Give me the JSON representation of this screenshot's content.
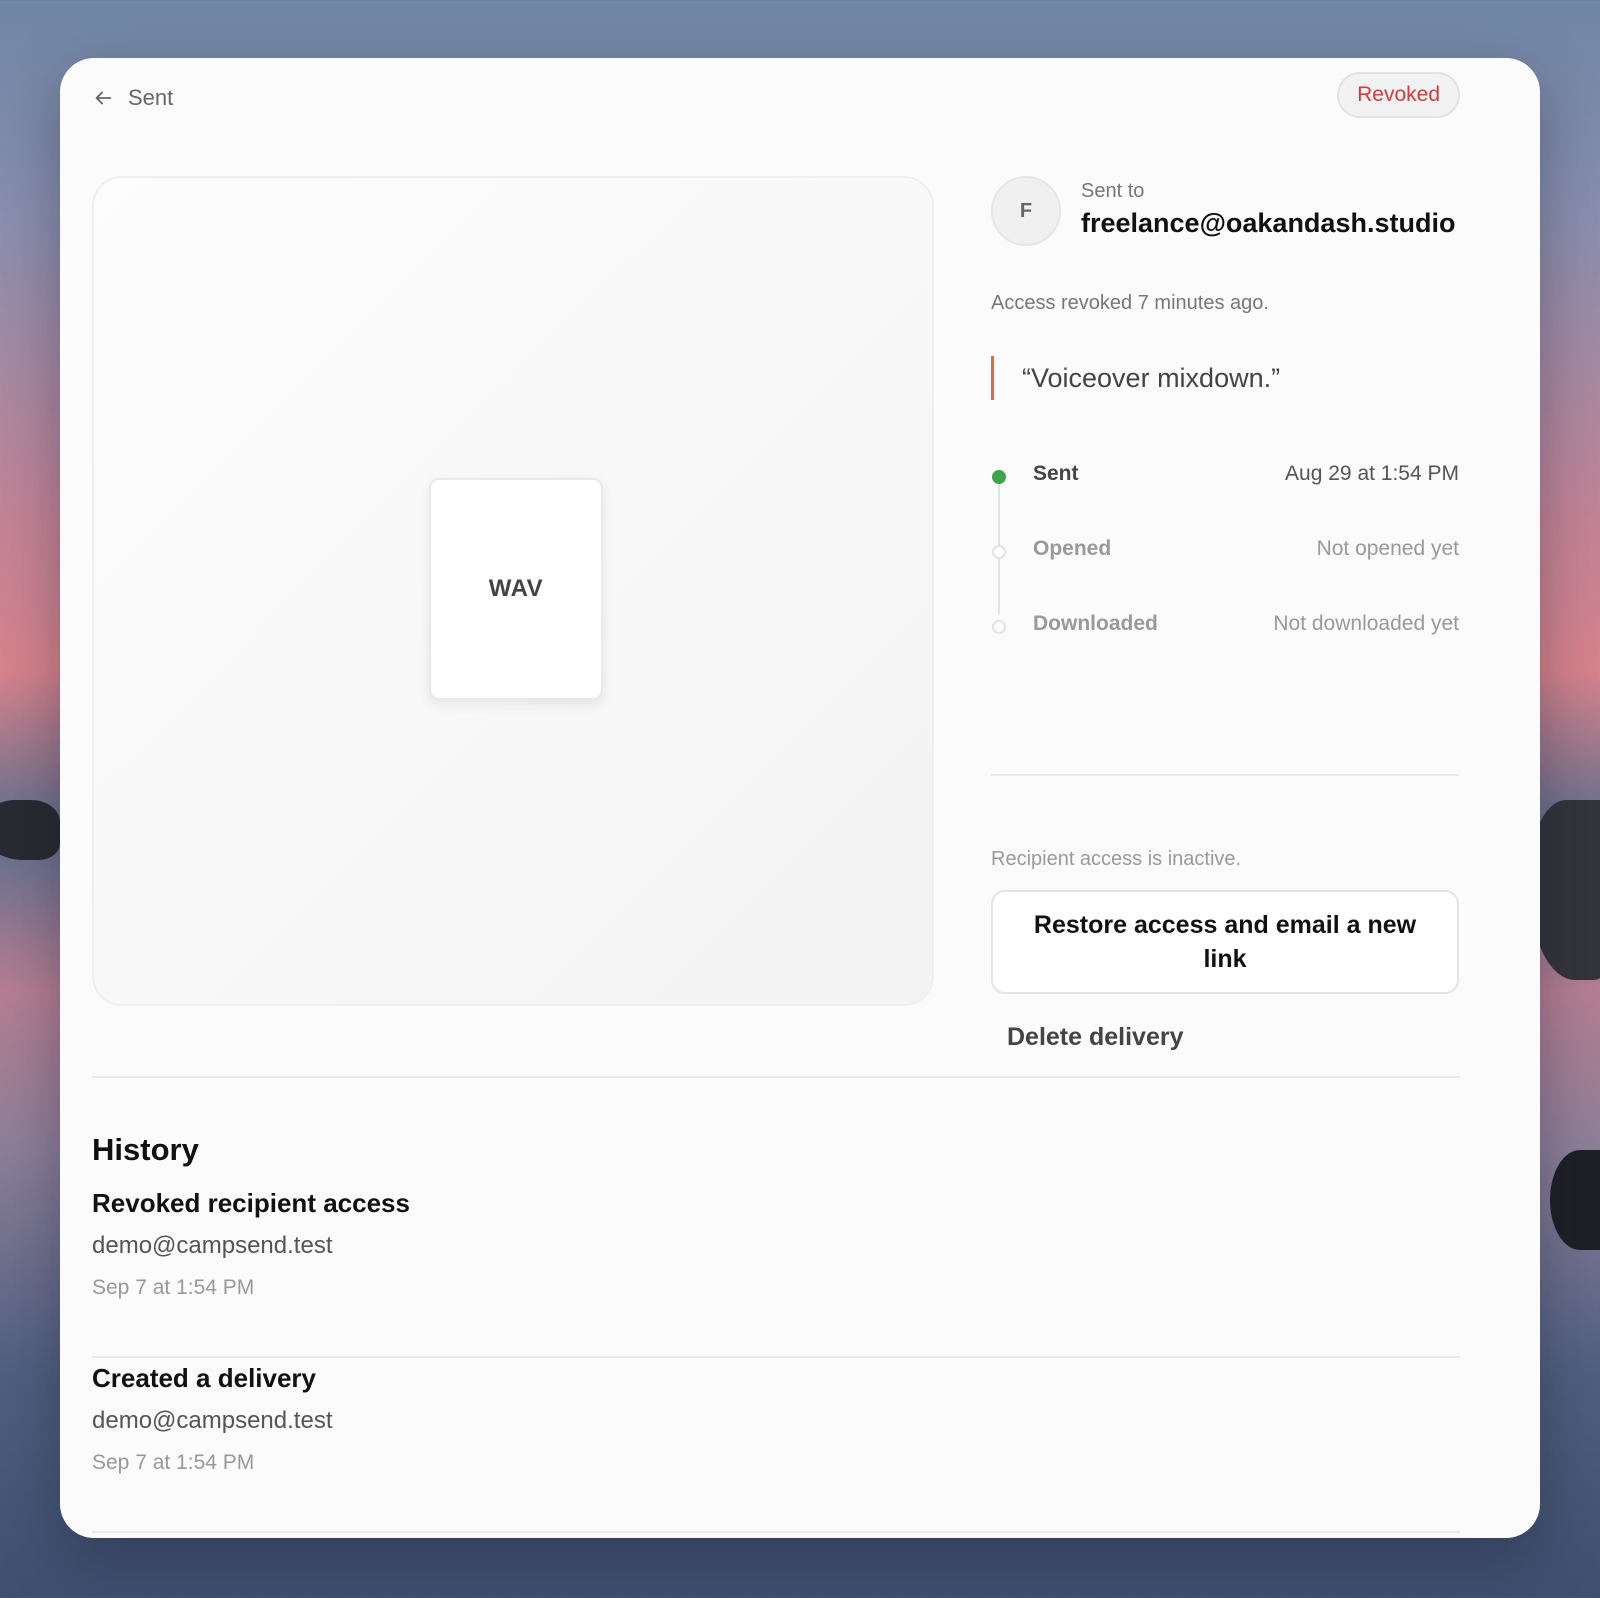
{
  "header": {
    "back_label": "Sent",
    "status_badge": "Revoked",
    "status_color": "#d33a3a"
  },
  "preview": {
    "file_type": "WAV"
  },
  "recipient": {
    "avatar_initial": "F",
    "sent_to_label": "Sent to",
    "email": "freelance@oakandash.studio"
  },
  "access_note": "Access revoked 7 minutes ago.",
  "message_quote": "“Voiceover mixdown.”",
  "timeline": [
    {
      "label": "Sent",
      "value": "Aug 29 at 1:54 PM",
      "done": true
    },
    {
      "label": "Opened",
      "value": "Not opened yet",
      "done": false
    },
    {
      "label": "Downloaded",
      "value": "Not downloaded yet",
      "done": false
    }
  ],
  "access_status": "Recipient access is inactive.",
  "actions": {
    "restore_label": "Restore access and email a new link",
    "delete_label": "Delete delivery"
  },
  "history": {
    "title": "History",
    "items": [
      {
        "action": "Revoked recipient access",
        "user": "demo@campsend.test",
        "time": "Sep 7 at 1:54 PM"
      },
      {
        "action": "Created a delivery",
        "user": "demo@campsend.test",
        "time": "Sep 7 at 1:54 PM"
      }
    ]
  },
  "colors": {
    "accent_quote": "#e26a3c",
    "timeline_done": "#3ea34a"
  }
}
